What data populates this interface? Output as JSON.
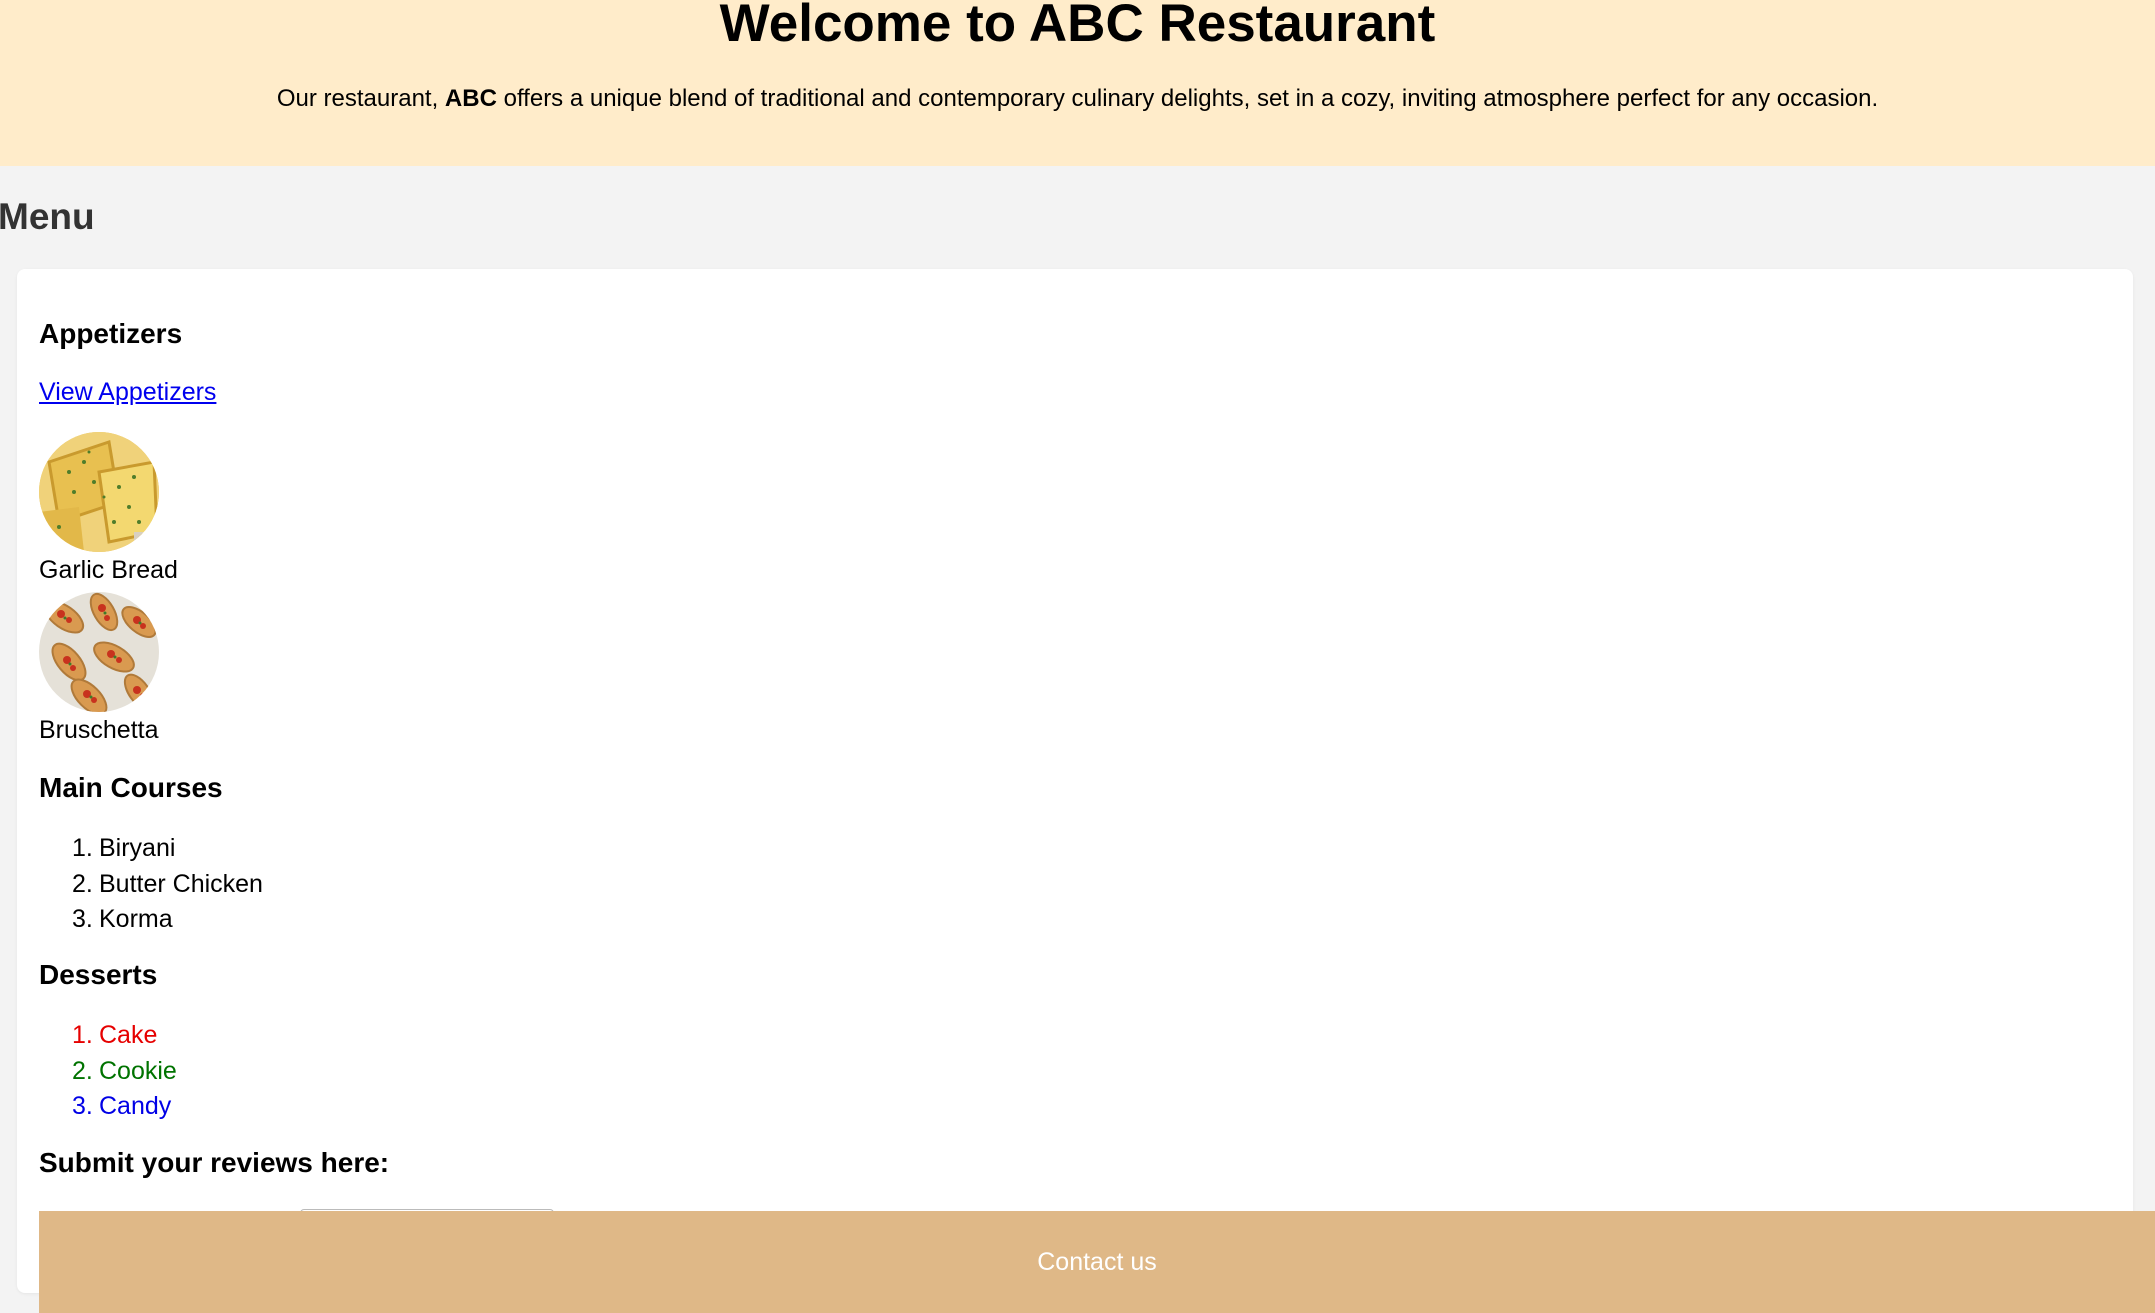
{
  "header": {
    "title": "Welcome to ABC Restaurant",
    "intro_before": "Our restaurant, ",
    "intro_brand": "ABC",
    "intro_after": " offers a unique blend of traditional and contemporary culinary delights, set in a cozy, inviting atmosphere perfect for any occasion.",
    "background_color": "#ffecca"
  },
  "menu": {
    "title": "Menu",
    "appetizers": {
      "title": "Appetizers",
      "link_label": "View Appetizers",
      "items": [
        {
          "name": "Garlic Bread",
          "image": "garlic-bread-photo"
        },
        {
          "name": "Bruschetta",
          "image": "bruschetta-photo"
        }
      ]
    },
    "main_courses": {
      "title": "Main Courses",
      "items": [
        {
          "num": "1.",
          "name": "Biryani"
        },
        {
          "num": "2.",
          "name": "Butter Chicken"
        },
        {
          "num": "3.",
          "name": "Korma"
        }
      ]
    },
    "desserts": {
      "title": "Desserts",
      "items": [
        {
          "num": "1.",
          "name": "Cake",
          "color": "#e60000"
        },
        {
          "num": "2.",
          "name": "Cookie",
          "color": "#007300"
        },
        {
          "num": "3.",
          "name": "Candy",
          "color": "#0000e6"
        }
      ]
    },
    "reviews": {
      "title": "Submit your reviews here:"
    }
  },
  "footer": {
    "label": "Contact us",
    "background_color": "#dfb887"
  }
}
